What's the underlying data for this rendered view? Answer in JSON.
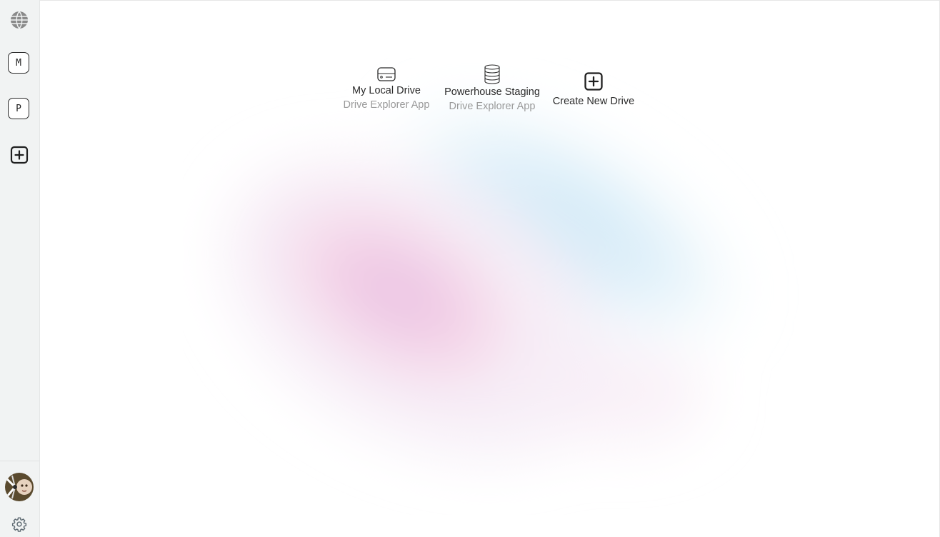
{
  "sidebar": {
    "logo_icon": "globe-icon",
    "drives": [
      {
        "initial": "M"
      },
      {
        "initial": "P"
      }
    ],
    "add_icon": "plus-square-icon",
    "avatar_icon": "user-avatar",
    "settings_icon": "gear-icon"
  },
  "main": {
    "drives": [
      {
        "name": "My Local Drive",
        "app": "Drive Explorer App",
        "icon": "hard-drive-icon"
      },
      {
        "name": "Powerhouse Staging",
        "app": "Drive Explorer App",
        "icon": "database-icon"
      }
    ],
    "create_new": {
      "label": "Create New Drive",
      "icon": "plus-square-icon"
    }
  },
  "colors": {
    "sidebar_bg": "#f1f3f3",
    "text_primary": "#2b2b2b",
    "text_secondary": "#9a9a9a",
    "blob_pink": "#f2c7e3",
    "blob_blue": "#cfe8f7"
  }
}
